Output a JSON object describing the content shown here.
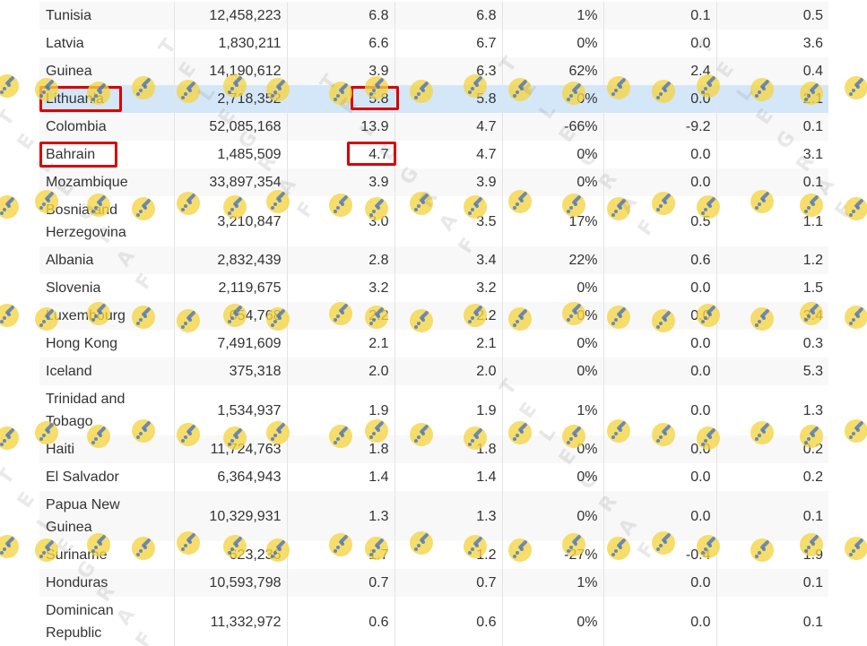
{
  "table": {
    "rows": [
      {
        "country": "Tunisia",
        "population": "12,458,223",
        "c1": "6.8",
        "c2": "6.8",
        "pct": "1%",
        "change": "0.1",
        "last": "0.5"
      },
      {
        "country": "Latvia",
        "population": "1,830,211",
        "c1": "6.6",
        "c2": "6.7",
        "pct": "0%",
        "change": "0.0",
        "last": "3.6"
      },
      {
        "country": "Guinea",
        "population": "14,190,612",
        "c1": "3.9",
        "c2": "6.3",
        "pct": "62%",
        "change": "2.4",
        "last": "0.4"
      },
      {
        "country": "Lithuania",
        "population": "2,718,352",
        "c1": "5.8",
        "c2": "5.8",
        "pct": "0%",
        "change": "0.0",
        "last": "2.1"
      },
      {
        "country": "Colombia",
        "population": "52,085,168",
        "c1": "13.9",
        "c2": "4.7",
        "pct": "-66%",
        "change": "-9.2",
        "last": "0.1"
      },
      {
        "country": "Bahrain",
        "population": "1,485,509",
        "c1": "4.7",
        "c2": "4.7",
        "pct": "0%",
        "change": "0.0",
        "last": "3.1"
      },
      {
        "country": "Mozambique",
        "population": "33,897,354",
        "c1": "3.9",
        "c2": "3.9",
        "pct": "0%",
        "change": "0.0",
        "last": "0.1"
      },
      {
        "country": "Bosnia and Herzegovina",
        "population": "3,210,847",
        "c1": "3.0",
        "c2": "3.5",
        "pct": "17%",
        "change": "0.5",
        "last": "1.1"
      },
      {
        "country": "Albania",
        "population": "2,832,439",
        "c1": "2.8",
        "c2": "3.4",
        "pct": "22%",
        "change": "0.6",
        "last": "1.2"
      },
      {
        "country": "Slovenia",
        "population": "2,119,675",
        "c1": "3.2",
        "c2": "3.2",
        "pct": "0%",
        "change": "0.0",
        "last": "1.5"
      },
      {
        "country": "Luxembourg",
        "population": "654,768",
        "c1": "2.2",
        "c2": "2.2",
        "pct": "0%",
        "change": "0.0",
        "last": "3.4"
      },
      {
        "country": "Hong Kong",
        "population": "7,491,609",
        "c1": "2.1",
        "c2": "2.1",
        "pct": "0%",
        "change": "0.0",
        "last": "0.3"
      },
      {
        "country": "Iceland",
        "population": "375,318",
        "c1": "2.0",
        "c2": "2.0",
        "pct": "0%",
        "change": "0.0",
        "last": "5.3"
      },
      {
        "country": "Trinidad and Tobago",
        "population": "1,534,937",
        "c1": "1.9",
        "c2": "1.9",
        "pct": "1%",
        "change": "0.0",
        "last": "1.3"
      },
      {
        "country": "Haiti",
        "population": "11,724,763",
        "c1": "1.8",
        "c2": "1.8",
        "pct": "0%",
        "change": "0.0",
        "last": "0.2"
      },
      {
        "country": "El Salvador",
        "population": "6,364,943",
        "c1": "1.4",
        "c2": "1.4",
        "pct": "0%",
        "change": "0.0",
        "last": "0.2"
      },
      {
        "country": "Papua New Guinea",
        "population": "10,329,931",
        "c1": "1.3",
        "c2": "1.3",
        "pct": "0%",
        "change": "0.0",
        "last": "0.1"
      },
      {
        "country": "Suriname",
        "population": "623,236",
        "c1": "1.7",
        "c2": "1.2",
        "pct": "-27%",
        "change": "-0.4",
        "last": "1.9"
      },
      {
        "country": "Honduras",
        "population": "10,593,798",
        "c1": "0.7",
        "c2": "0.7",
        "pct": "1%",
        "change": "0.0",
        "last": "0.1"
      },
      {
        "country": "Dominican Republic",
        "population": "11,332,972",
        "c1": "0.6",
        "c2": "0.6",
        "pct": "0%",
        "change": "0.0",
        "last": "0.1"
      }
    ]
  },
  "highlighted_row": "Lithuania",
  "annotated_countries": [
    "Lithuania",
    "Bahrain"
  ],
  "colors": {
    "highlight_row": "#d4e7f9",
    "annotation_box": "#d90000",
    "watermark_logo": "#f4d342",
    "text": "#333333"
  },
  "watermark": {
    "icon": "telegraf-logo-icon",
    "letters": "TELEGRAF"
  }
}
